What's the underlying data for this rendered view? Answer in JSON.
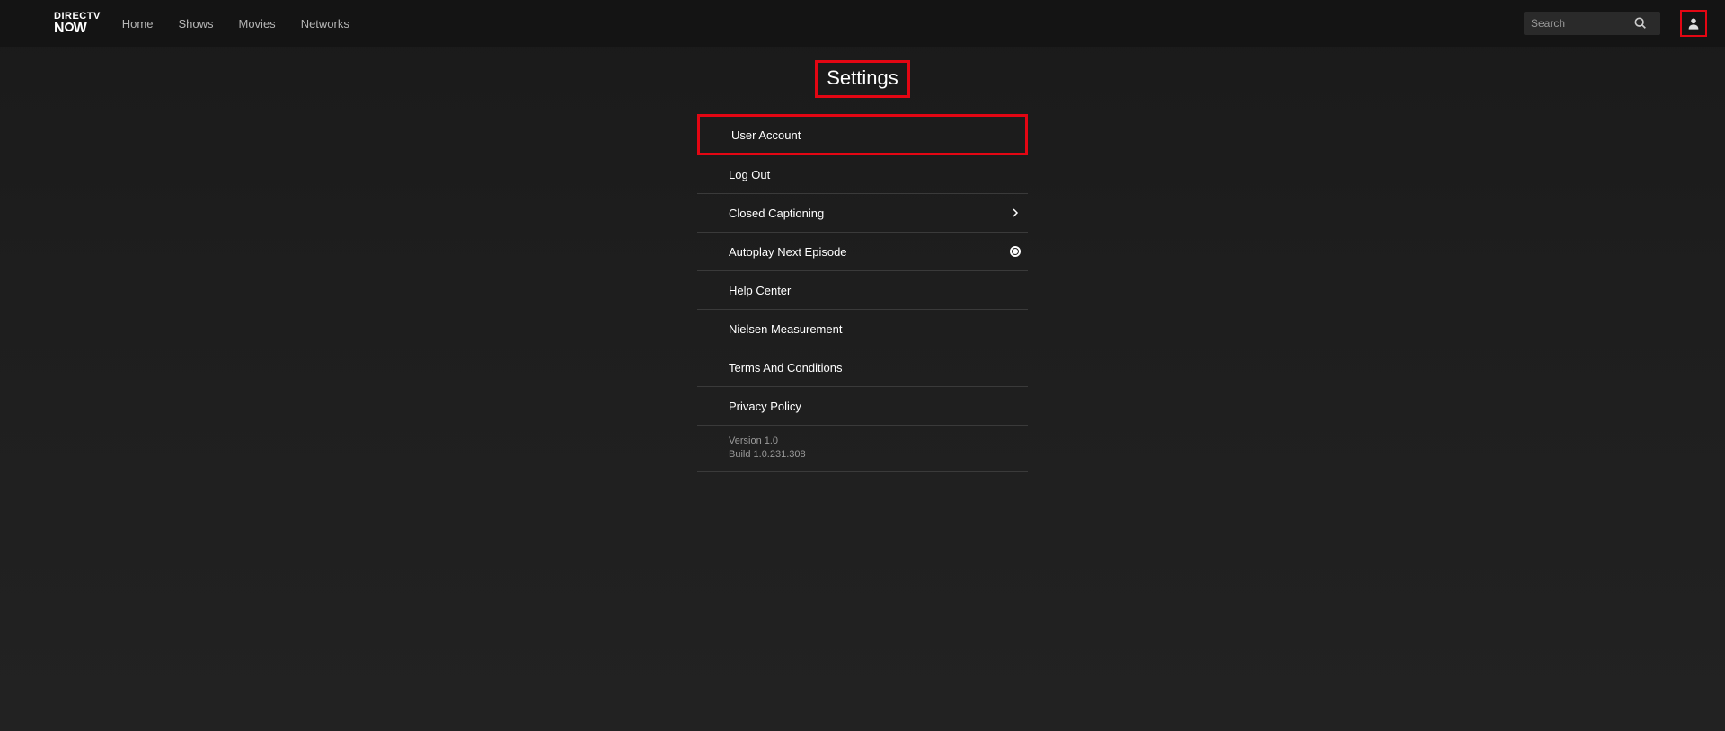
{
  "brand": {
    "line1": "DIRECTV",
    "line2": "NOW"
  },
  "nav": {
    "items": [
      "Home",
      "Shows",
      "Movies",
      "Networks"
    ]
  },
  "search": {
    "placeholder": "Search"
  },
  "page": {
    "title": "Settings"
  },
  "settings": {
    "rows": [
      {
        "label": "User Account",
        "icon": null,
        "highlight": true
      },
      {
        "label": "Log Out",
        "icon": null
      },
      {
        "label": "Closed Captioning",
        "icon": "chevron"
      },
      {
        "label": "Autoplay Next Episode",
        "icon": "radio-on"
      },
      {
        "label": "Help Center",
        "icon": null
      },
      {
        "label": "Nielsen Measurement",
        "icon": null
      },
      {
        "label": "Terms And Conditions",
        "icon": null
      },
      {
        "label": "Privacy Policy",
        "icon": null
      }
    ],
    "version": "Version 1.0",
    "build": "Build 1.0.231.308"
  }
}
